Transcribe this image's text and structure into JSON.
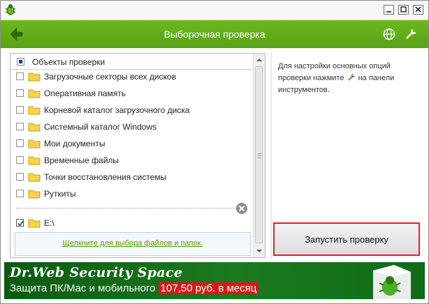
{
  "window": {
    "minimize_icon": "minimize-icon",
    "maximize_icon": "maximize-icon",
    "close_icon": "close-icon"
  },
  "header": {
    "title": "Выборочная проверка",
    "icons": [
      "back-arrow-icon",
      "globe-icon",
      "wrench-icon"
    ]
  },
  "objects": {
    "header_label": "Объекты проверки",
    "header_checkbox_state": "partial",
    "items": [
      {
        "label": "Загрузочные секторы всех дисков",
        "checked": false
      },
      {
        "label": "Оперативная память",
        "checked": false
      },
      {
        "label": "Корневой каталог загрузочного диска",
        "checked": false
      },
      {
        "label": "Системный каталог Windows",
        "checked": false
      },
      {
        "label": "Мои документы",
        "checked": false
      },
      {
        "label": "Временные файлы",
        "checked": false
      },
      {
        "label": "Точки восстановления системы",
        "checked": false
      },
      {
        "label": "Руткиты",
        "checked": false
      }
    ],
    "custom_items": [
      {
        "label": "E:\\",
        "checked": true
      }
    ],
    "pick_link": "Щелкните для выбора файлов и папок."
  },
  "help": {
    "text_before": "Для настройки основных опций проверки нажмите ",
    "text_after": " на панели инструментов."
  },
  "actions": {
    "run_label": "Запустить проверку"
  },
  "banner": {
    "title": "Dr.Web Security Space",
    "subtitle": "Защита ПК/Mac и мобильного ",
    "price": "107,50 руб. в месяц"
  },
  "colors": {
    "accent_green": "#5aa215",
    "highlight_red": "#d8232a",
    "link_green": "#4a9a0f",
    "banner_green": "#1b7a1e"
  }
}
